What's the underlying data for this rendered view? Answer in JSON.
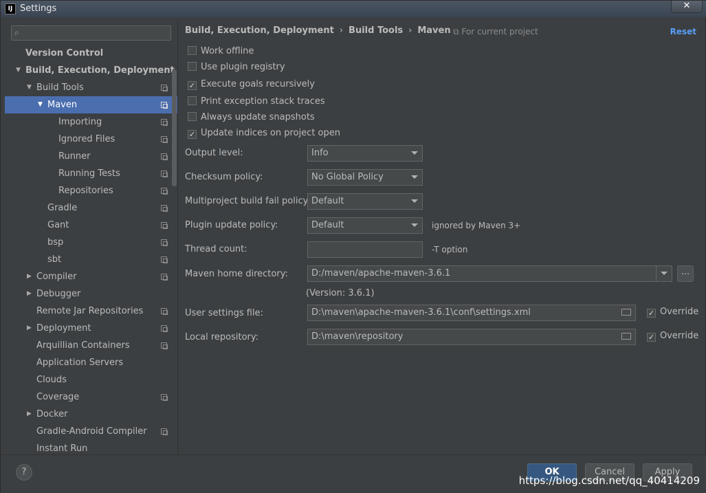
{
  "window": {
    "title": "Settings",
    "close_label": "✕",
    "app_icon": "IJ"
  },
  "sidebar": {
    "search_placeholder": "",
    "items": [
      {
        "label": "Version Control",
        "level": 0,
        "bold": true,
        "arrow": "",
        "page_icon": false
      },
      {
        "label": "Build, Execution, Deployment",
        "level": 0,
        "bold": true,
        "arrow": "▼",
        "page_icon": false
      },
      {
        "label": "Build Tools",
        "level": 1,
        "arrow": "▼",
        "page_icon": true
      },
      {
        "label": "Maven",
        "level": 2,
        "arrow": "▼",
        "page_icon": true,
        "selected": true
      },
      {
        "label": "Importing",
        "level": 3,
        "arrow": "",
        "page_icon": true
      },
      {
        "label": "Ignored Files",
        "level": 3,
        "arrow": "",
        "page_icon": true
      },
      {
        "label": "Runner",
        "level": 3,
        "arrow": "",
        "page_icon": true
      },
      {
        "label": "Running Tests",
        "level": 3,
        "arrow": "",
        "page_icon": true
      },
      {
        "label": "Repositories",
        "level": 3,
        "arrow": "",
        "page_icon": true
      },
      {
        "label": "Gradle",
        "level": 2,
        "arrow": "",
        "page_icon": true
      },
      {
        "label": "Gant",
        "level": 2,
        "arrow": "",
        "page_icon": true
      },
      {
        "label": "bsp",
        "level": 2,
        "arrow": "",
        "page_icon": true
      },
      {
        "label": "sbt",
        "level": 2,
        "arrow": "",
        "page_icon": true
      },
      {
        "label": "Compiler",
        "level": 1,
        "arrow": "▶",
        "page_icon": true
      },
      {
        "label": "Debugger",
        "level": 1,
        "arrow": "▶",
        "page_icon": false
      },
      {
        "label": "Remote Jar Repositories",
        "level": 1,
        "arrow": "",
        "page_icon": true
      },
      {
        "label": "Deployment",
        "level": 1,
        "arrow": "▶",
        "page_icon": true
      },
      {
        "label": "Arquillian Containers",
        "level": 1,
        "arrow": "",
        "page_icon": true
      },
      {
        "label": "Application Servers",
        "level": 1,
        "arrow": "",
        "page_icon": false
      },
      {
        "label": "Clouds",
        "level": 1,
        "arrow": "",
        "page_icon": false
      },
      {
        "label": "Coverage",
        "level": 1,
        "arrow": "",
        "page_icon": true
      },
      {
        "label": "Docker",
        "level": 1,
        "arrow": "▶",
        "page_icon": false
      },
      {
        "label": "Gradle-Android Compiler",
        "level": 1,
        "arrow": "",
        "page_icon": true
      },
      {
        "label": "Instant Run",
        "level": 1,
        "arrow": "",
        "page_icon": false
      }
    ]
  },
  "main": {
    "breadcrumb": [
      "Build, Execution, Deployment",
      "Build Tools",
      "Maven"
    ],
    "breadcrumb_sep": "›",
    "for_current_project": "For current project",
    "reset_label": "Reset",
    "checkboxes": [
      {
        "label": "Work offline",
        "checked": false
      },
      {
        "label": "Use plugin registry",
        "checked": false
      },
      {
        "label": "Execute goals recursively",
        "checked": true
      },
      {
        "label": "Print exception stack traces",
        "checked": false
      },
      {
        "label": "Always update snapshots",
        "checked": false
      },
      {
        "label": "Update indices on project open",
        "checked": true
      }
    ],
    "output_level": {
      "label": "Output level:",
      "value": "Info"
    },
    "checksum_policy": {
      "label": "Checksum policy:",
      "value": "No Global Policy"
    },
    "multiproject_policy": {
      "label": "Multiproject build fail policy:",
      "value": "Default"
    },
    "plugin_update_policy": {
      "label": "Plugin update policy:",
      "value": "Default",
      "hint": "ignored by Maven 3+"
    },
    "thread_count": {
      "label": "Thread count:",
      "value": "",
      "hint": "-T option"
    },
    "maven_home": {
      "label": "Maven home directory:",
      "value": "D:/maven/apache-maven-3.6.1",
      "browse_label": "...",
      "version": "(Version: 3.6.1)"
    },
    "user_settings": {
      "label": "User settings file:",
      "value": "D:\\maven\\apache-maven-3.6.1\\conf\\settings.xml",
      "override_label": "Override",
      "override_checked": true
    },
    "local_repo": {
      "label": "Local repository:",
      "value": "D:\\maven\\repository",
      "override_label": "Override",
      "override_checked": true
    }
  },
  "footer": {
    "help_label": "?",
    "ok_label": "OK",
    "cancel_label": "Cancel",
    "apply_label": "Apply",
    "watermark": "https://blog.csdn.net/qq_40414209"
  },
  "colors": {
    "background": "#3c3f41",
    "selection": "#4b6eaf",
    "link": "#589df6",
    "ok_button": "#365880"
  }
}
